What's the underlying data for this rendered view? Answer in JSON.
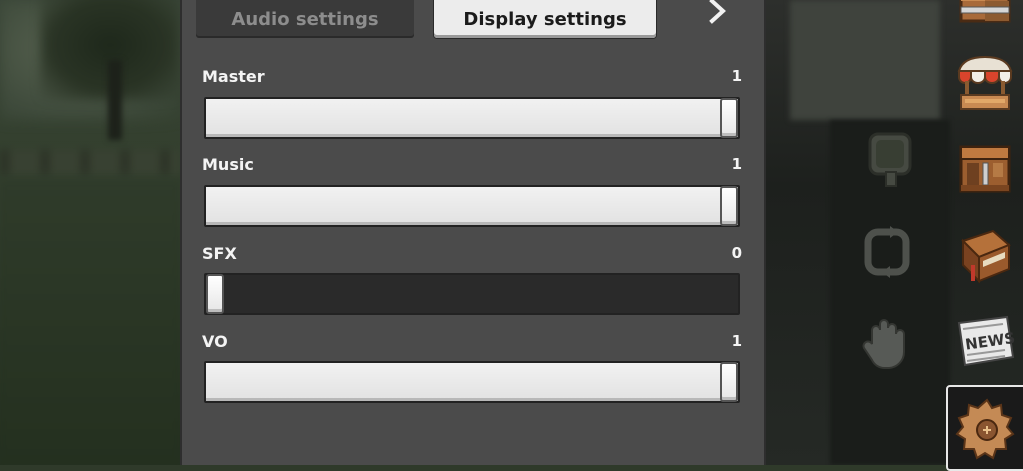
{
  "tabs": {
    "audio": "Audio settings",
    "display": "Display settings"
  },
  "sliders": [
    {
      "label": "Master",
      "value": "1",
      "level": 1
    },
    {
      "label": "Music",
      "value": "1",
      "level": 1
    },
    {
      "label": "SFX",
      "value": "0",
      "level": 0
    },
    {
      "label": "VO",
      "value": "1",
      "level": 1
    }
  ],
  "sidebar": {
    "icons": [
      "crafting-block-icon",
      "shop-stall-icon",
      "workbench-icon",
      "book-icon",
      "news-icon",
      "settings-gear-icon"
    ],
    "news_label": "NEWS"
  },
  "colors": {
    "panel": "#4b4b4b",
    "slider_fill": "#e9e9e9",
    "slider_track": "#2a2a2a",
    "active_tab": "#ececec"
  }
}
